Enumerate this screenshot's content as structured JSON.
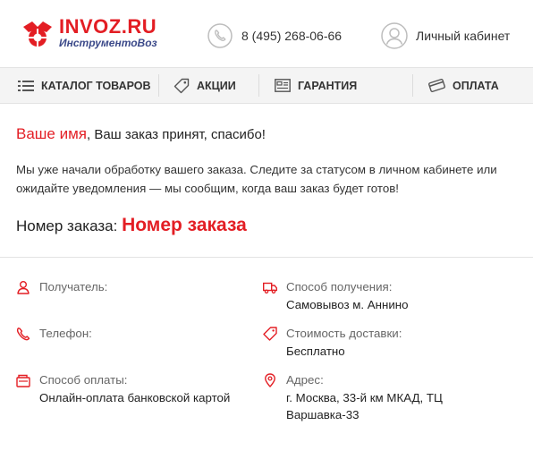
{
  "header": {
    "logo_top": "INVOZ.RU",
    "logo_bottom": "ИнструментоВоз",
    "phone": "8 (495) 268-06-66",
    "account": "Личный кабинет"
  },
  "nav": {
    "items": [
      {
        "label": "КАТАЛОГ ТОВАРОВ",
        "icon": "list-icon"
      },
      {
        "label": "АКЦИИ",
        "icon": "tag-icon"
      },
      {
        "label": "ГАРАНТИЯ",
        "icon": "certificate-icon"
      },
      {
        "label": "ОПЛАТА",
        "icon": "card-icon"
      }
    ]
  },
  "confirmation": {
    "name": "Ваше имя",
    "greeting_rest": ", Ваш заказ принят, спасибо!",
    "info": "Мы уже начали обработку вашего заказа. Следите за статусом в личном кабинете или ожидайте уведомления — мы сообщим, когда ваш заказ будет готов!",
    "order_label": "Номер заказа: ",
    "order_number": "Номер заказа"
  },
  "details": {
    "recipient_label": "Получатель:",
    "phone_label": "Телефон:",
    "payment_label": "Способ оплаты:",
    "payment_value": "Онлайн-оплата банковской картой",
    "delivery_method_label": "Способ получения:",
    "delivery_method_value": "Самовывоз м. Аннино",
    "delivery_cost_label": "Стоимость доставки:",
    "delivery_cost_value": "Бесплатно",
    "address_label": "Адрес:",
    "address_value": "г. Москва, 33-й км МКАД, ТЦ Варшавка-33"
  },
  "colors": {
    "accent": "#e31e24",
    "logo_blue": "#3c4a8a",
    "nav_bg": "#f4f4f4"
  }
}
